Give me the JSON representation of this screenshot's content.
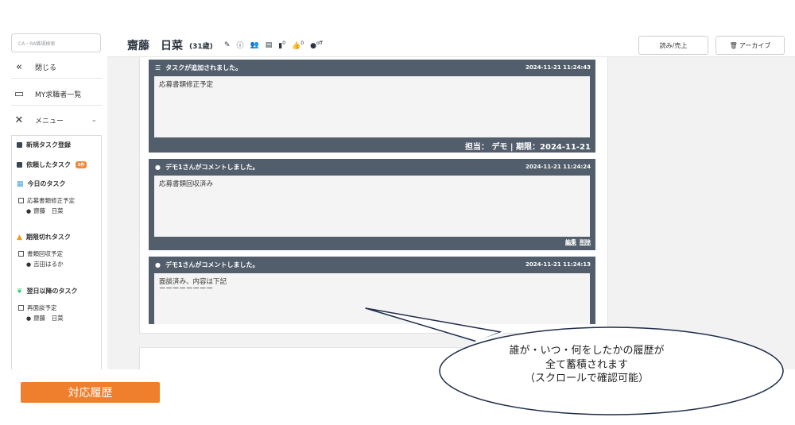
{
  "sidebar": {
    "search_placeholder": "CA・RA職場検索",
    "close_label": "閉じる",
    "mylist_label": "MY求職者一覧",
    "menu_label": "メニュー",
    "menu": {
      "new_task": "新規タスク登録",
      "requested_task": "依頼したタスク",
      "requested_badge": "8件",
      "today_task": "今日のタスク",
      "today_item": "応募書類修正予定",
      "today_person": "齋藤　日菜",
      "overdue_task": "期限切れタスク",
      "overdue_item": "書類回収予定",
      "overdue_person": "吉田はるか",
      "future_task": "翌日以降のタスク",
      "future_item": "再面談予定",
      "future_person": "齋藤　日菜"
    }
  },
  "header": {
    "name": "齋藤　日菜",
    "age": "(31歳)",
    "sup_doc": "0",
    "sup_like": "0",
    "sup_off": "off",
    "btn_read": "読み/売上",
    "btn_archive": "アーカイブ"
  },
  "timeline": {
    "cards": [
      {
        "title": "タスクが追加されました。",
        "time": "2024-11-21 11:24:43",
        "body": "応募書類修正予定",
        "footer": "担当： デモ | 期限：2024-11-21"
      },
      {
        "title": "デモ1さんがコメントしました。",
        "time": "2024-11-21 11:24:24",
        "body": "応募書類回収済み",
        "edit": "編集",
        "delete": "削除"
      },
      {
        "title": "デモ1さんがコメントしました。",
        "time": "2024-11-21 11:24:13",
        "body_line1": "面談済み、内容は下記",
        "body_line2": "ーーーーーーーー"
      }
    ]
  },
  "callout": {
    "line1": "誰が・いつ・何をしたかの履歴が",
    "line2": "全て蓄積されます",
    "line3": "（スクロールで確認可能）"
  },
  "label": "対応履歴"
}
